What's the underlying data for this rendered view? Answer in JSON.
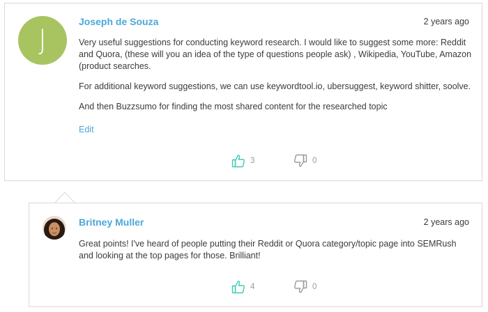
{
  "comments": [
    {
      "author": "Joseph de Souza",
      "avatar_letter": "J",
      "time": "2 years ago",
      "paragraphs": [
        "Very useful suggestions for conducting keyword research. I would like to suggest some more: Reddit and Quora, (these will you an idea of the type of questions people ask) , Wikipedia, YouTube, Amazon (product searches.",
        "For additional keyword suggestions, we can use keywordtool.io, ubersuggest, keyword shitter, soolve.",
        "And then Buzzsumo for finding the most shared content for the researched topic"
      ],
      "edit_label": "Edit",
      "upvotes": "3",
      "downvotes": "0"
    },
    {
      "author": "Britney Muller",
      "time": "2 years ago",
      "paragraphs": [
        "Great points! I've heard of people putting their Reddit or Quora category/topic page into SEMRush and looking at the top pages for those. Brilliant!"
      ],
      "upvotes": "4",
      "downvotes": "0"
    }
  ],
  "icons": {
    "upvote": "thumbs-up-icon",
    "downvote": "thumbs-down-icon"
  },
  "colors": {
    "link": "#4aa8d8",
    "avatar_bg": "#a8c460",
    "thumbs_up": "#3ec9b4",
    "thumbs_down": "#9a9a9a",
    "border": "#d9d9d9"
  }
}
